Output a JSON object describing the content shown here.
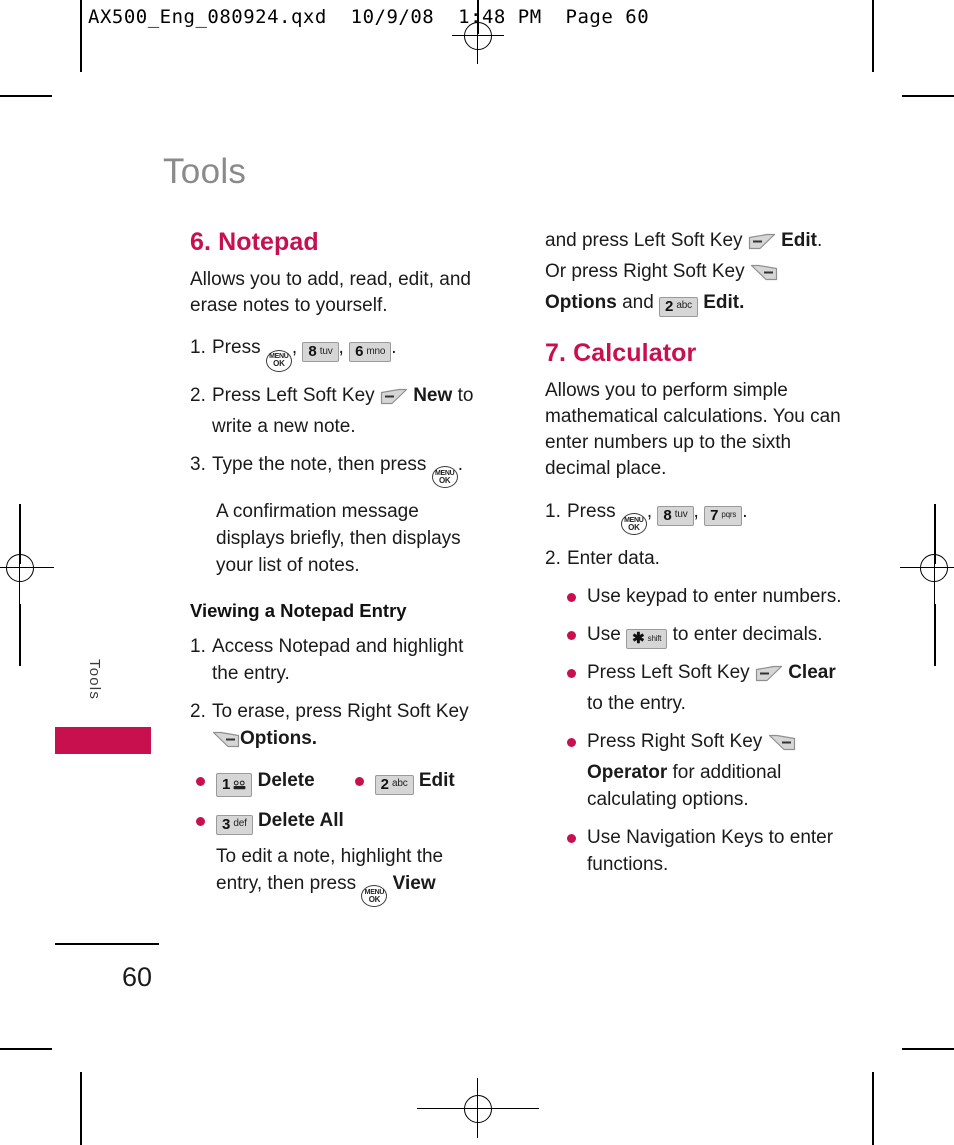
{
  "proof": {
    "header_text": "AX500_Eng_080924.qxd  10/9/08  1:48 PM  Page 60"
  },
  "page": {
    "chapter_title": "Tools",
    "side_tab_label": "Tools",
    "folio": "60",
    "accent_color": "#c8104e",
    "chapter_title_color": "#8a8a8a"
  },
  "keys": {
    "menu_ok_line1": "MENU",
    "menu_ok_line2": "OK",
    "k1_digit": "1",
    "k1_label": "voicemail",
    "k2_digit": "2",
    "k2_label": "abc",
    "k3_digit": "3",
    "k3_label": "def",
    "k6_digit": "6",
    "k6_label": "mno",
    "k7_digit": "7",
    "k7_label": "pqrs",
    "k8_digit": "8",
    "k8_label": "tuv",
    "kstar_digit": "✱",
    "kstar_label": "shift"
  },
  "left_column": {
    "section": {
      "heading": "6. Notepad",
      "intro": "Allows you to add, read, edit, and erase notes to yourself."
    },
    "steps": [
      {
        "num": "1.",
        "text_a": "Press",
        "text_b": ",",
        "text_c": ",",
        "text_d": "."
      },
      {
        "num": "2.",
        "text_a": "Press Left Soft Key",
        "bold": "New",
        "text_b": "to write a new note."
      },
      {
        "num": "3.",
        "text_a": "Type the note, then press",
        "text_b": "."
      }
    ],
    "confirmation_note": "A confirmation message displays briefly, then displays your list of notes.",
    "subhead": "Viewing a Notepad Entry",
    "view_steps": [
      {
        "num": "1.",
        "text": "Access Notepad and highlight the entry."
      },
      {
        "num": "2.",
        "text_a": "To erase, press Right Soft Key",
        "bold": "Options."
      }
    ],
    "option_bullets": [
      {
        "label": "Delete"
      },
      {
        "label": "Edit"
      },
      {
        "label": "Delete All"
      }
    ],
    "edit_note_a": "To edit a note, highlight the entry, then press",
    "edit_note_bold": "View"
  },
  "right_column": {
    "continuation": {
      "line_a": "and press Left Soft Key",
      "bold_a": "Edit",
      "line_b": ". Or press Right Soft Key",
      "bold_b": "Options",
      "line_c": "and",
      "bold_c": "Edit."
    },
    "section": {
      "heading": "7. Calculator",
      "intro": "Allows you to perform simple mathematical calculations. You can enter numbers up to the sixth decimal place."
    },
    "steps": [
      {
        "num": "1.",
        "text_a": "Press",
        "text_b": ",",
        "text_c": ",",
        "text_d": "."
      },
      {
        "num": "2.",
        "text": "Enter data."
      }
    ],
    "bullets": [
      {
        "text": "Use keypad to enter numbers."
      },
      {
        "text_a": "Use",
        "text_b": "to enter decimals."
      },
      {
        "text_a": "Press Left Soft Key",
        "bold": "Clear",
        "text_b": "to the entry."
      },
      {
        "text_a": "Press Right Soft Key",
        "bold": "Operator",
        "text_b": "for additional calculating options."
      },
      {
        "text": "Use Navigation Keys to enter functions."
      }
    ]
  }
}
